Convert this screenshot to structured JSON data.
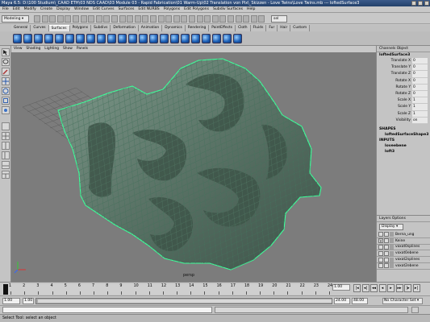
{
  "window": {
    "title": "Maya 6.5: D:\\100 Studium\\_CAAD ETH\\03 NDS CAAD\\03 Module 03 - Rapid Fabrication\\01 Warm-Up\\02 Translation von Pix\\_Skizzen - Love Twins\\Love Twins.mb --- loftedSurface3"
  },
  "menubar": [
    "File",
    "Edit",
    "Modify",
    "Create",
    "Display",
    "Window",
    "Edit Curves",
    "Surfaces",
    "Edit NURBS",
    "Polygons",
    "Edit Polygons",
    "Subdiv Surfaces",
    "Help"
  ],
  "statusline": {
    "mode": "Modeling",
    "sel_field": "sel"
  },
  "shelf": {
    "tabs": [
      "General",
      "Curves",
      "Surfaces",
      "Polygons",
      "Subdivs",
      "Deformation",
      "Animation",
      "Dynamics",
      "Rendering",
      "PaintEffects",
      "Cloth",
      "Fluids",
      "Fur",
      "Hair",
      "Custom"
    ],
    "active_tab": "Surfaces",
    "icon_count": 22
  },
  "viewport": {
    "menu": [
      "View",
      "Shading",
      "Lighting",
      "Show",
      "Panels"
    ],
    "camera_label": "persp",
    "surface_color": "#5a7366",
    "wire_color": "#3cff9a",
    "bg_color": "#7c7c7c"
  },
  "channelbox": {
    "header": "Channels  Object",
    "node": "loftedSurface3",
    "attributes": [
      {
        "name": "Translate X",
        "value": "0"
      },
      {
        "name": "Translate Y",
        "value": "0"
      },
      {
        "name": "Translate Z",
        "value": "0"
      },
      {
        "name": "Rotate X",
        "value": "0"
      },
      {
        "name": "Rotate Y",
        "value": "0"
      },
      {
        "name": "Rotate Z",
        "value": "0"
      },
      {
        "name": "Scale X",
        "value": "1"
      },
      {
        "name": "Scale Y",
        "value": "1"
      },
      {
        "name": "Scale Z",
        "value": "1"
      },
      {
        "name": "Visibility",
        "value": "on"
      }
    ],
    "shapes_label": "SHAPES",
    "shape_name": "loftedSurfaceShape3",
    "inputs_label": "INPUTS",
    "inputs": [
      "loveebene",
      "loft3"
    ]
  },
  "layers": {
    "header": "Layers  Options",
    "display_select": "Display",
    "items": [
      {
        "vis": "",
        "name": "Berna_ung"
      },
      {
        "vis": "V",
        "name": "Keine"
      },
      {
        "vis": "",
        "name": "voxat0splines"
      },
      {
        "vis": "",
        "name": "voxat0ebene"
      },
      {
        "vis": "",
        "name": "voxat2splines"
      },
      {
        "vis": "",
        "name": "voxat2ebene"
      }
    ]
  },
  "timeslider": {
    "ticks": [
      "1",
      "2",
      "3",
      "4",
      "5",
      "6",
      "7",
      "8",
      "9",
      "10",
      "11",
      "12",
      "13",
      "14",
      "15",
      "16",
      "17",
      "18",
      "19",
      "20",
      "21",
      "22",
      "23",
      "24"
    ],
    "current_frame": "1.00"
  },
  "playback": {
    "buttons": [
      "|◂",
      "◂|",
      "◂◂",
      "◂",
      "▸",
      "▸▸",
      "|▸",
      "▸|"
    ]
  },
  "rangeslider": {
    "start": "1.00",
    "inner_start": "1.00",
    "inner_end": "24.00",
    "end": "48.00",
    "character_set": "No Character Set"
  },
  "helpline": {
    "text": "Select Tool: select an object"
  }
}
